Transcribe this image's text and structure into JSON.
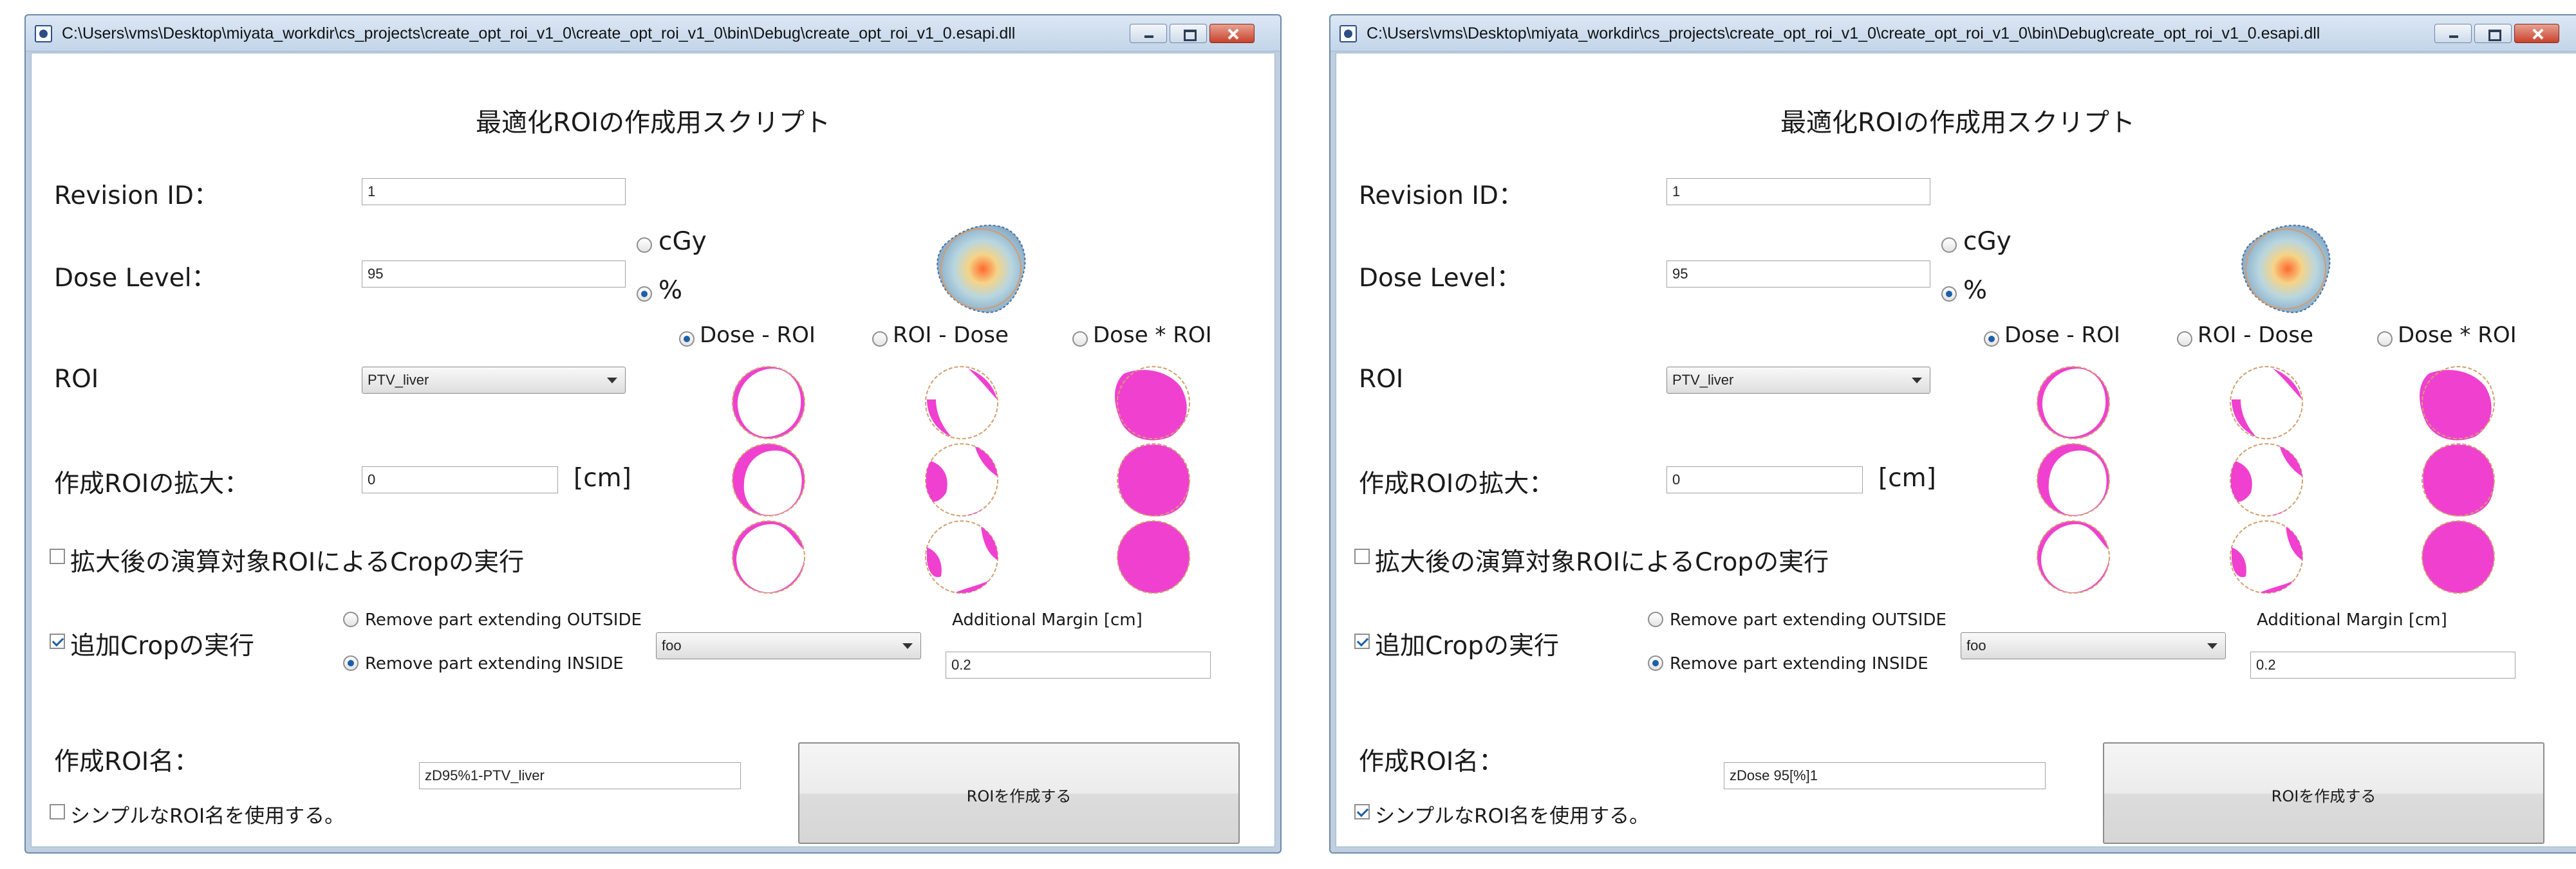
{
  "windows": [
    {
      "title": "C:\\Users\\vms\\Desktop\\miyata_workdir\\cs_projects\\create_opt_roi_v1_0\\create_opt_roi_v1_0\\bin\\Debug\\create_opt_roi_v1_0.esapi.dll",
      "header": "最適化ROIの作成用スクリプト",
      "revision_id": {
        "label": "Revision ID：",
        "value": "1"
      },
      "dose_level": {
        "label": "Dose Level：",
        "value": "95"
      },
      "units": [
        {
          "label": "cGy",
          "selected": false
        },
        {
          "label": "%",
          "selected": true
        }
      ],
      "roi": {
        "label": "ROI",
        "value": "PTV_liver"
      },
      "margin": {
        "label": "作成ROIの拡大：",
        "value": "0",
        "unit": "[cm]"
      },
      "operations": [
        {
          "label": "Dose - ROI",
          "selected": true
        },
        {
          "label": "ROI - Dose",
          "selected": false
        },
        {
          "label": "Dose * ROI",
          "selected": false
        }
      ],
      "crop_after_expand": {
        "label": "拡大後の演算対象ROIによるCropの実行",
        "checked": false
      },
      "extra_crop": {
        "label": "追加Cropの実行",
        "checked": true
      },
      "crop_options": [
        {
          "label": "Remove part extending OUTSIDE",
          "selected": false
        },
        {
          "label": "Remove part extending INSIDE",
          "selected": true
        }
      ],
      "crop_structure": "foo",
      "additional_margin": {
        "label": "Additional Margin [cm]",
        "value": "0.2"
      },
      "roi_name": {
        "label": "作成ROI名：",
        "value": "zD95%1-PTV_liver"
      },
      "simple_name": {
        "label": "シンプルなROI名を使用する。",
        "checked": false
      },
      "create_button": "ROIを作成する",
      "colors": {
        "magenta": "#f040cf",
        "accent": "#1c5fa8"
      }
    },
    {
      "title": "C:\\Users\\vms\\Desktop\\miyata_workdir\\cs_projects\\create_opt_roi_v1_0\\create_opt_roi_v1_0\\bin\\Debug\\create_opt_roi_v1_0.esapi.dll",
      "header": "最適化ROIの作成用スクリプト",
      "revision_id": {
        "label": "Revision ID：",
        "value": "1"
      },
      "dose_level": {
        "label": "Dose Level：",
        "value": "95"
      },
      "units": [
        {
          "label": "cGy",
          "selected": false
        },
        {
          "label": "%",
          "selected": true
        }
      ],
      "roi": {
        "label": "ROI",
        "value": "PTV_liver"
      },
      "margin": {
        "label": "作成ROIの拡大：",
        "value": "0",
        "unit": "[cm]"
      },
      "operations": [
        {
          "label": "Dose - ROI",
          "selected": true
        },
        {
          "label": "ROI - Dose",
          "selected": false
        },
        {
          "label": "Dose * ROI",
          "selected": false
        }
      ],
      "crop_after_expand": {
        "label": "拡大後の演算対象ROIによるCropの実行",
        "checked": false
      },
      "extra_crop": {
        "label": "追加Cropの実行",
        "checked": true
      },
      "crop_options": [
        {
          "label": "Remove part extending OUTSIDE",
          "selected": false
        },
        {
          "label": "Remove part extending INSIDE",
          "selected": true
        }
      ],
      "crop_structure": "foo",
      "additional_margin": {
        "label": "Additional Margin [cm]",
        "value": "0.2"
      },
      "roi_name": {
        "label": "作成ROI名：",
        "value": "zDose 95[%]1"
      },
      "simple_name": {
        "label": "シンプルなROI名を使用する。",
        "checked": true
      },
      "create_button": "ROIを作成する",
      "colors": {
        "magenta": "#f040cf",
        "accent": "#1c5fa8"
      }
    }
  ]
}
